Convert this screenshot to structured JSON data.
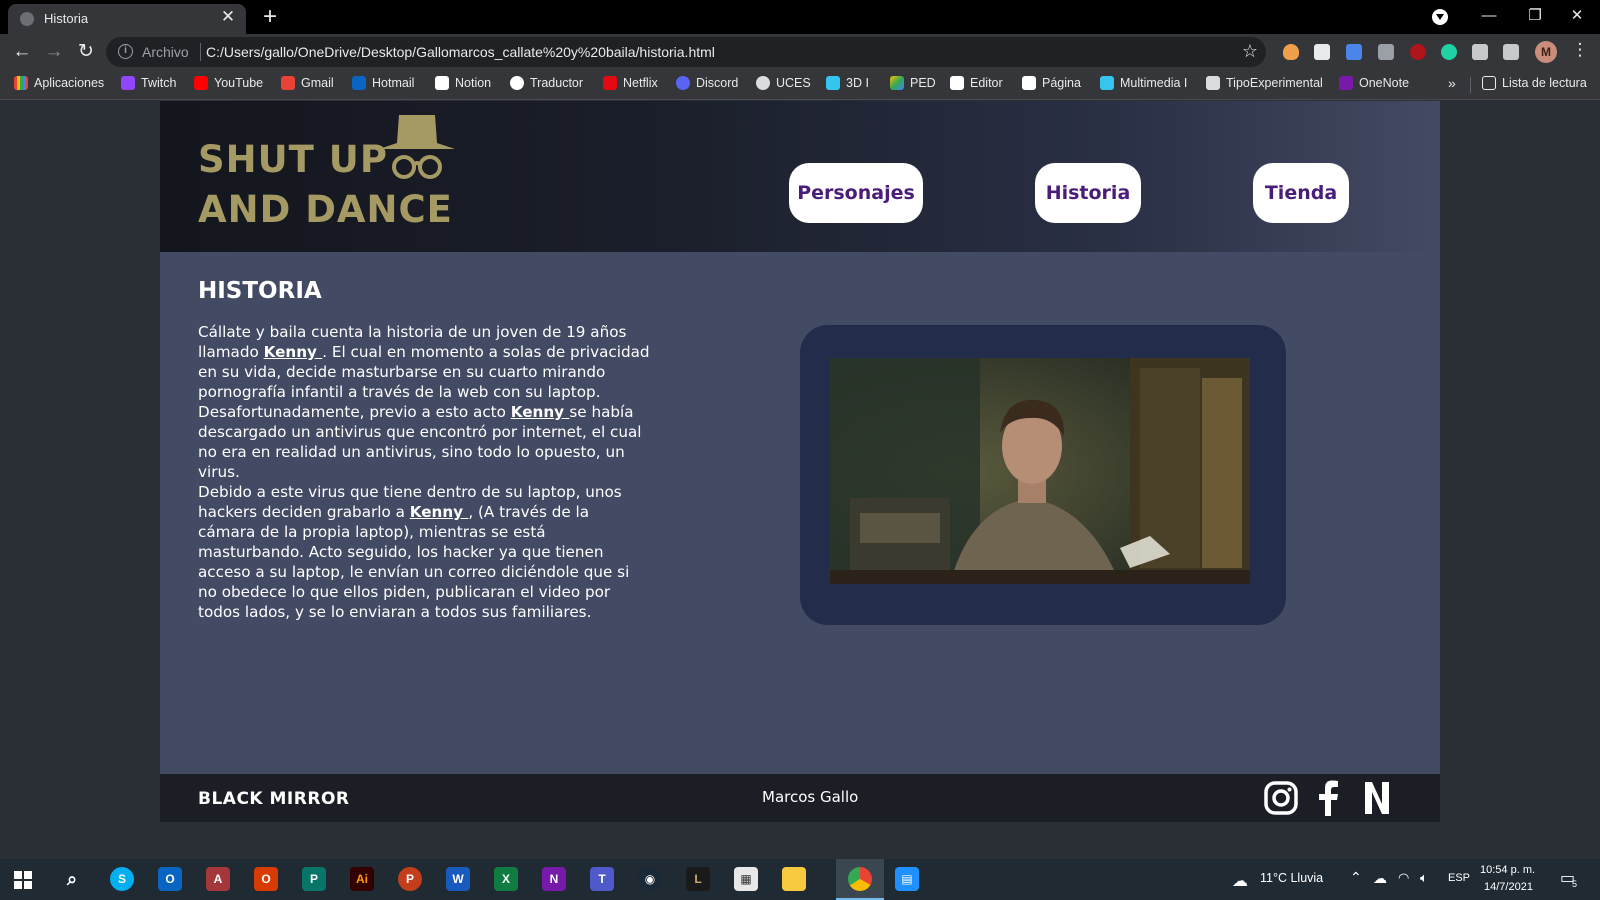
{
  "browser": {
    "tab_title": "Historia",
    "omnibox_scheme": "Archivo",
    "url": "C:/Users/gallo/OneDrive/Desktop/Gallomarcos_callate%20y%20baila/historia.html",
    "bookmarks": [
      "Aplicaciones",
      "Twitch",
      "YouTube",
      "Gmail",
      "Hotmail",
      "Notion",
      "Traductor",
      "Netflix",
      "Discord",
      "UCES",
      "3D I",
      "PED",
      "Editor",
      "Página",
      "Multimedia I",
      "TipoExperimental",
      "OneNote"
    ],
    "reading_list": "Lista de lectura",
    "profile_initial": "M"
  },
  "site": {
    "logo_line1": "SHUT UP",
    "logo_line2": "AND DANCE",
    "nav": [
      "Personajes",
      "Historia",
      "Tienda"
    ],
    "heading": "HISTORIA",
    "p1": {
      "t1": "Cállate y baila cuenta la historia de un joven de 19 años llamado ",
      "link1": "Kenny ",
      "t2": ". El cual en momento a solas de privacidad en su vida, decide masturbarse en su cuarto mirando pornografía infantil a través de la web con su laptop. Desafortunadamente, previo a esto acto ",
      "link2": "Kenny ",
      "t3": "se había descargado un antivirus que encontró por internet, el cual no era en realidad un antivirus, sino todo lo opuesto, un virus."
    },
    "p2": {
      "t1": "Debido a este virus que tiene dentro de su laptop, unos hackers deciden grabarlo a ",
      "link1": "Kenny ",
      "t2": ", (A través de la cámara de la propia laptop), mientras se está masturbando. Acto seguido, los hacker ya que tienen acceso a su laptop, le envían un correo diciéndole que si no obedece lo que ellos piden, publicaran el video por todos lados, y se lo enviaran a todos sus familiares."
    },
    "footer_brand": "BLACK MIRROR",
    "footer_name": "Marcos Gallo",
    "social": [
      "instagram-icon",
      "facebook-icon",
      "netflix-icon"
    ]
  },
  "taskbar": {
    "weather": "11°C  Lluvia",
    "lang": "ESP",
    "time": "10:54 p. m.",
    "date": "14/7/2021",
    "notif_count": "5"
  },
  "colors": {
    "site_bg": "#434a63",
    "header_dark": "#14161d",
    "logo_gold": "#a59a63",
    "nav_text": "#4a1d7a",
    "video_frame": "#232c4a",
    "footer_bg": "#1b1e25"
  }
}
